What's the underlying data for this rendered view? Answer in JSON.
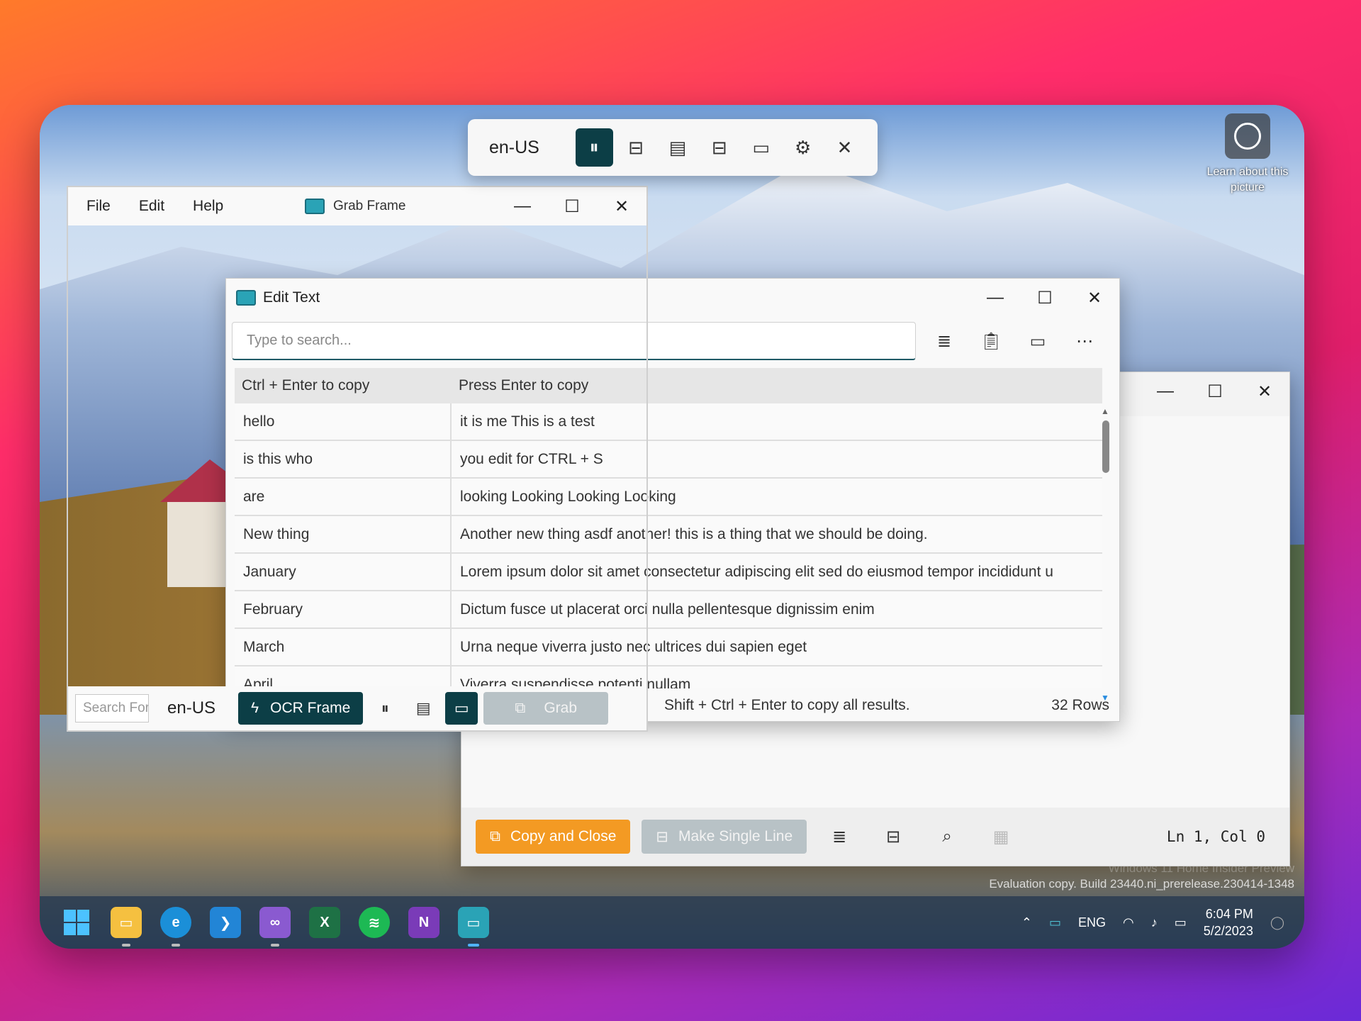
{
  "desktop": {
    "learn_text": "Learn about this picture",
    "watermark_line1": "Windows 11 Home Insider Preview",
    "watermark_line2": "Evaluation copy. Build 23440.ni_prerelease.230414-1348"
  },
  "fullscreen_toolbar": {
    "language": "en-US",
    "icons": [
      "pause-icon",
      "single-line-icon",
      "table-icon",
      "standard-mode-icon",
      "window-icon",
      "gear-icon",
      "close-icon"
    ]
  },
  "grab_frame": {
    "menu": [
      "File",
      "Edit",
      "Help"
    ],
    "title": "Grab Frame",
    "search_placeholder": "Search For",
    "language": "en-US",
    "ocr_button": "OCR Frame",
    "grab_button": "Grab"
  },
  "edit_text": {
    "title": "Edit Text",
    "search_placeholder": "Type to search...",
    "headers": [
      "Ctrl + Enter to copy",
      "Press Enter to copy"
    ],
    "rows": [
      [
        "hello",
        "it is me This is a test"
      ],
      [
        "is this who",
        "you edit for CTRL + S"
      ],
      [
        "are",
        "looking Looking Looking Looking"
      ],
      [
        "New thing",
        "Another new thing asdf another! this is a thing that we should be doing."
      ],
      [
        "January",
        "Lorem ipsum dolor sit amet  consectetur adipiscing elit  sed do eiusmod tempor incididunt u"
      ],
      [
        "February",
        "Dictum fusce ut placerat orci nulla pellentesque dignissim enim"
      ],
      [
        "March",
        "Urna neque viverra justo nec ultrices dui sapien eget"
      ],
      [
        "April",
        "Viverra suspendisse potenti nullam"
      ]
    ],
    "footer_hint": "Shift + Ctrl + Enter to copy all results.",
    "row_count": "32 Rows"
  },
  "background_window": {
    "copy_close": "Copy and Close",
    "single_line": "Make Single Line",
    "status": "Ln 1, Col 0"
  },
  "taskbar": {
    "lang": "ENG",
    "time": "6:04 PM",
    "date": "5/2/2023",
    "colors": {
      "accent": "#0c3e46",
      "orange": "#f39a23"
    }
  }
}
